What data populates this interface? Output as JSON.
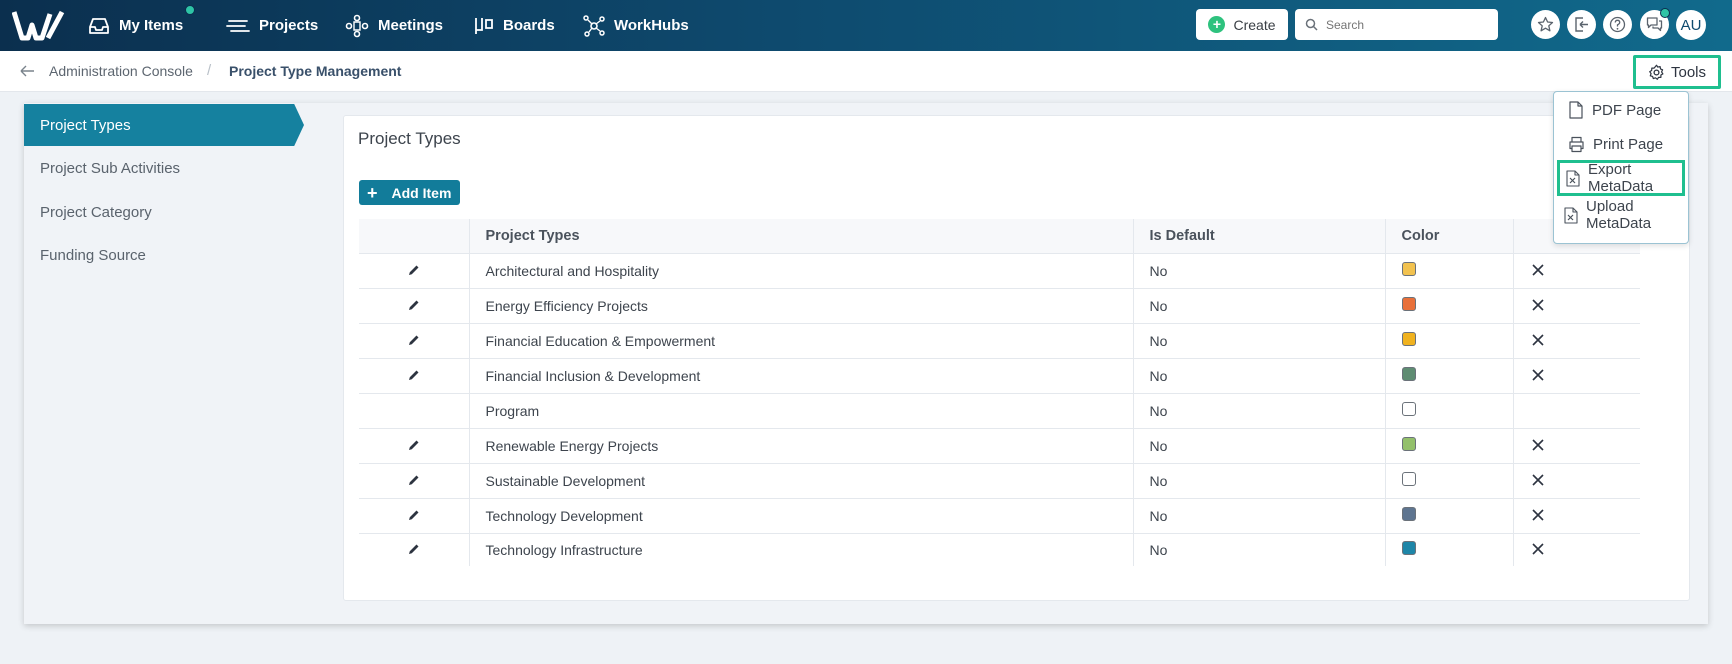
{
  "nav": {
    "items": [
      {
        "label": "My Items",
        "icon": "inbox-icon"
      },
      {
        "label": "Projects",
        "icon": "projects-icon"
      },
      {
        "label": "Meetings",
        "icon": "meetings-icon"
      },
      {
        "label": "Boards",
        "icon": "boards-icon"
      },
      {
        "label": "WorkHubs",
        "icon": "workhubs-icon"
      }
    ],
    "create_label": "Create",
    "search_placeholder": "Search",
    "avatar_initials": "AU"
  },
  "breadcrumb": {
    "parent": "Administration Console",
    "separator": "/",
    "current": "Project Type Management"
  },
  "tools": {
    "label": "Tools",
    "menu": [
      {
        "label": "PDF Page",
        "icon": "pdf-icon"
      },
      {
        "label": "Print Page",
        "icon": "print-icon"
      },
      {
        "label": "Export MetaData",
        "icon": "excel-icon"
      },
      {
        "label": "Upload MetaData",
        "icon": "excel-icon"
      }
    ]
  },
  "sidebar": {
    "items": [
      {
        "label": "Project Types",
        "active": true
      },
      {
        "label": "Project Sub Activities",
        "active": false
      },
      {
        "label": "Project Category",
        "active": false
      },
      {
        "label": "Funding Source",
        "active": false
      }
    ]
  },
  "main": {
    "title": "Project Types",
    "add_label": "Add Item",
    "columns": [
      "Project Types",
      "Is Default",
      "Color"
    ],
    "rows": [
      {
        "name": "Architectural and Hospitality",
        "is_default": "No",
        "color": "#f2c24f",
        "editable": true
      },
      {
        "name": "Energy Efficiency Projects",
        "is_default": "No",
        "color": "#e8703a",
        "editable": true
      },
      {
        "name": "Financial Education & Empowerment",
        "is_default": "No",
        "color": "#f0b21f",
        "editable": true
      },
      {
        "name": "Financial Inclusion & Development",
        "is_default": "No",
        "color": "#5e8c72",
        "editable": true
      },
      {
        "name": "Program",
        "is_default": "No",
        "color": "#ffffff",
        "editable": false
      },
      {
        "name": "Renewable Energy Projects",
        "is_default": "No",
        "color": "#93c06b",
        "editable": true
      },
      {
        "name": "Sustainable Development",
        "is_default": "No",
        "color": "#ffffff",
        "editable": true
      },
      {
        "name": "Technology Development",
        "is_default": "No",
        "color": "#5e7590",
        "editable": true
      },
      {
        "name": "Technology Infrastructure",
        "is_default": "No",
        "color": "#1e86a8",
        "editable": true
      }
    ]
  }
}
